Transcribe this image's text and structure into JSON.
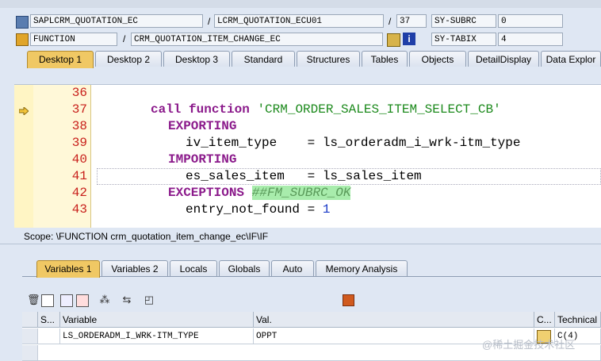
{
  "header": {
    "program": "SAPLCRM_QUOTATION_EC",
    "include": "LCRM_QUOTATION_ECU01",
    "line": "37",
    "sysvar1_name": "SY-SUBRC",
    "sysvar1_value": "0",
    "type": "FUNCTION",
    "function_name": "CRM_QUOTATION_ITEM_CHANGE_EC",
    "sysvar2_name": "SY-TABIX",
    "sysvar2_value": "4"
  },
  "desktop_tabs": [
    "Desktop 1",
    "Desktop 2",
    "Desktop 3",
    "Standard",
    "Structures",
    "Tables",
    "Objects",
    "DetailDisplay",
    "Data Explor"
  ],
  "code": {
    "line_numbers": [
      "36",
      "37",
      "38",
      "39",
      "40",
      "41",
      "42",
      "43"
    ],
    "l37_kw1": "call function",
    "l37_str": "'CRM_ORDER_SALES_ITEM_SELECT_CB'",
    "l38": "EXPORTING",
    "l39": "iv_item_type    = ls_orderadm_i_wrk-itm_type",
    "l40": "IMPORTING",
    "l41": "es_sales_item   = ls_sales_item",
    "l42_kw": "EXCEPTIONS",
    "l42_cmt": "##FM_SUBRC_OK",
    "l43_text": "entry_not_found = ",
    "l43_num": "1"
  },
  "scope": "Scope: \\FUNCTION crm_quotation_item_change_ec\\IF\\IF",
  "var_tabs": [
    "Variables 1",
    "Variables 2",
    "Locals",
    "Globals",
    "Auto",
    "Memory Analysis"
  ],
  "grid": {
    "headers": [
      "S...",
      "Variable",
      "Val.",
      "C...",
      "Technical"
    ],
    "row": {
      "variable": "LS_ORDERADM_I_WRK-ITM_TYPE",
      "value": "OPPT",
      "type": "C(4)"
    }
  },
  "watermark": "@稀土掘金技术社区"
}
